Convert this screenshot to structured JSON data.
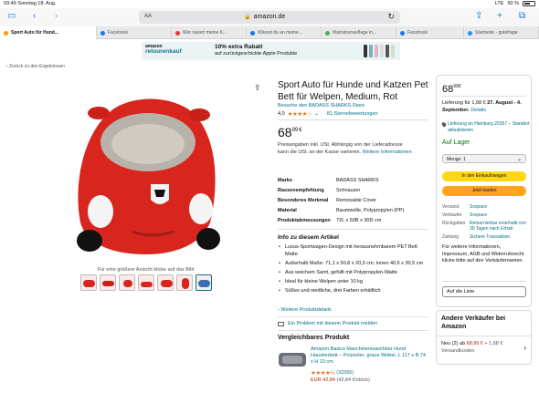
{
  "status": {
    "time_date": "03:46  Sonntag 18. Aug.",
    "network": "LTE",
    "battery": "50 %"
  },
  "browser": {
    "address_prefix": "AA",
    "url": "amazon.de",
    "tabs": [
      {
        "label": "Sport Auto für Hund...",
        "color": "#ff9900"
      },
      {
        "label": "Facebook",
        "color": "#1877f2"
      },
      {
        "label": "Wer rasiert meine K...",
        "color": "#e53935"
      },
      {
        "label": "Wärest du an meine...",
        "color": "#1877f2"
      },
      {
        "label": "Matratzenauflage in...",
        "color": "#4caf50"
      },
      {
        "label": "Facebook",
        "color": "#1877f2"
      },
      {
        "label": "Startseite - gutefrage",
        "color": "#2196f3"
      }
    ]
  },
  "banner": {
    "logo_top": "amazon",
    "logo_bottom": "retourenkauf",
    "line1": "10% extra Rabatt",
    "line2": "auf zurückgeschickte Apple Produkte"
  },
  "back_link": "‹ Zurück zu den Ergebnissen",
  "gallery": {
    "zoom_hint": "Für eine größere Ansicht klicke auf das Bild",
    "thumb_count": 7
  },
  "product": {
    "title": "Sport Auto für Hunde und Katzen Pet Bett für Welpen, Medium, Rot",
    "store": "Besuche den BADASS SHARKS-Store",
    "rating": "4,0",
    "stars": "★★★★☆",
    "rating_count": "81 Sternebewertungen",
    "price_whole": "68",
    "price_fraction": "99",
    "currency": "€",
    "vat_text": "Preisangaben inkl. USt. Abhängig von der Lieferadresse kann die USt. an der Kasse variieren.",
    "vat_link": "Weitere Informationen",
    "specs": [
      {
        "k": "Marke",
        "v": "BADASS SHARKS"
      },
      {
        "k": "Rassenempfehlung",
        "v": "Schnauzer"
      },
      {
        "k": "Besonderes Merkmal",
        "v": "Removable Cover"
      },
      {
        "k": "Material",
        "v": "Baumwolle, Polypropylen (PP)"
      },
      {
        "k": "Produktabmessungen",
        "v": "72L x 50B x 30D cm"
      }
    ],
    "about_title": "Info zu diesem Artikel",
    "about": [
      "Luxus-Sportwagen-Design mit herausnehmbarem PET Bett Matte",
      "Außerhalb Maße: 71,1 x 50,8 x 20,3 cm; Innen 40,6 x 30,5 cm",
      "Aus weichem Samt, gefüllt mit Polypropylen-Watte",
      "Ideal für kleine Welpen unter 10 kg",
      "Süßes und niedliche, drei Farben erhältlich"
    ],
    "more_details": "› Weitere Produktdetails",
    "report": "Ein Problem mit diesem Produkt melden"
  },
  "comparable": {
    "heading": "Vergleichbares Produkt",
    "title": "Amazon Basics Maschinenwaschbar Hund Haustierbett – Polyester, graue Wirbel, L 117 x B 74 x H 10 cm",
    "stars": "★★★★½",
    "count": "(32355)",
    "price": "EUR 42,84",
    "unit_price": "(42,84 €/stück)"
  },
  "buybox": {
    "price_whole": "68",
    "price_fraction": "99",
    "currency": "€",
    "delivery_prefix": "Lieferung für 1,68 € ",
    "delivery_date": "27. August - 4. September.",
    "delivery_link": "Details",
    "location": "Lieferung an Hamburg 20357 – Standort aktualisieren",
    "stock": "Auf Lager",
    "qty": "Menge: 1",
    "add_to_cart": "In den Einkaufswagen",
    "buy_now": "Jetzt kaufen",
    "info": [
      {
        "k": "Versand",
        "v": "Sxspace"
      },
      {
        "k": "Verkäufer",
        "v": "Sxspace"
      },
      {
        "k": "Rückgaben",
        "v": "Retournierbar innerhalb von 30 Tagen nach Erhalt"
      },
      {
        "k": "Zahlung",
        "v": "Sichere Transaktion"
      }
    ],
    "note": "Für weitere Informationen, Impressum, AGB und Widerrufsrecht klicke bitte auf den Verkäufernamen.",
    "add_to_list": "Auf die Liste"
  },
  "other_sellers": {
    "heading": "Andere Verkäufer bei Amazon",
    "prefix": "Neu (2) ab ",
    "price": "68,99 €",
    "shipping": " + 1,68 €",
    "shipping2": "Versandkosten"
  }
}
